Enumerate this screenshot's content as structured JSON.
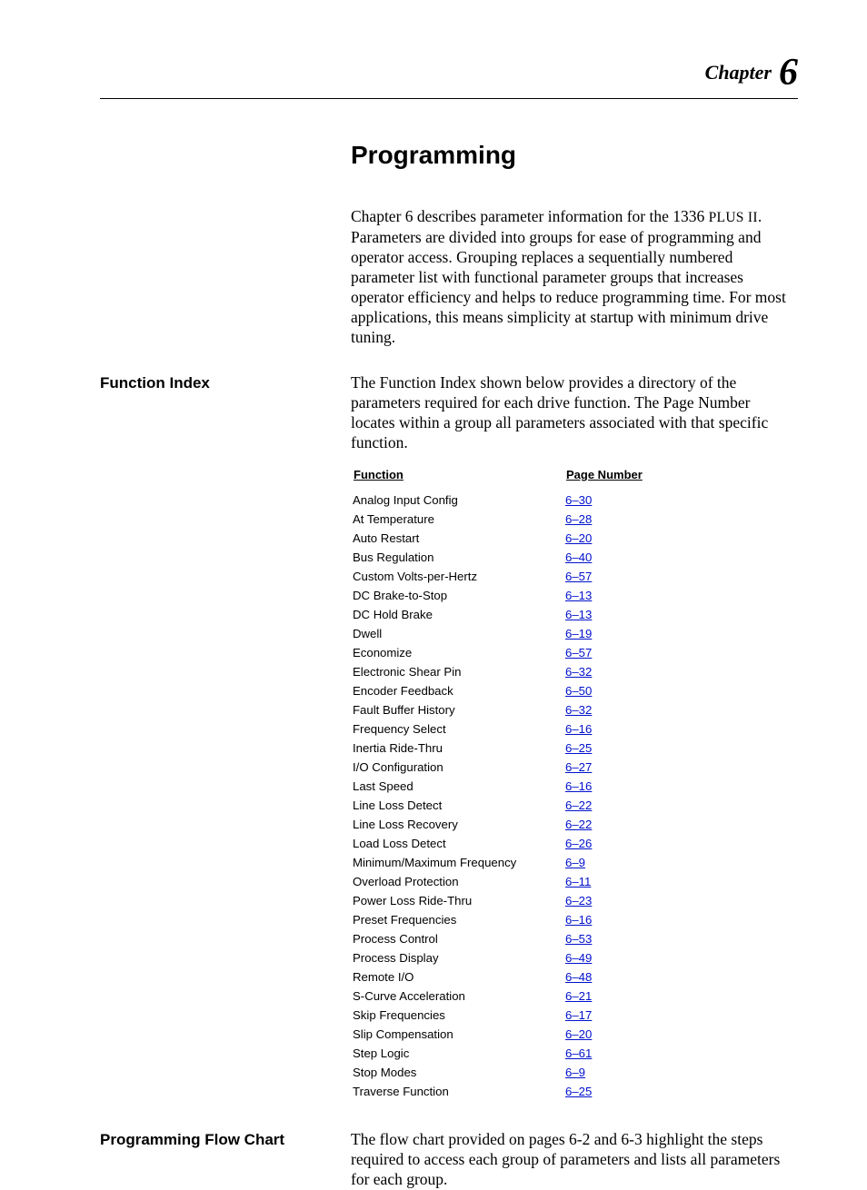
{
  "header": {
    "chapter_word": "Chapter",
    "chapter_number": "6"
  },
  "title": "Programming",
  "intro": "Chapter 6 describes parameter information for the 1336 PLUS II. Parameters are divided into groups for ease of programming and operator access. Grouping replaces a sequentially numbered parameter list with functional parameter groups that increases operator efficiency and helps to reduce programming time. For most applications, this means simplicity at startup with minimum drive tuning.",
  "function_index": {
    "heading": "Function Index",
    "body": "The Function Index shown below provides a directory of the parameters required for each drive function. The Page Number locates within a group all parameters associated with that specific function.",
    "table": {
      "col1": "Function",
      "col2": "Page Number",
      "rows": [
        {
          "f": "Analog Input Config",
          "p": "6–30"
        },
        {
          "f": "At Temperature",
          "p": "6–28"
        },
        {
          "f": "Auto Restart",
          "p": "6–20"
        },
        {
          "f": "Bus Regulation",
          "p": "6–40"
        },
        {
          "f": "Custom Volts-per-Hertz",
          "p": "6–57"
        },
        {
          "f": "DC Brake-to-Stop",
          "p": "6–13"
        },
        {
          "f": "DC Hold Brake",
          "p": "6–13"
        },
        {
          "f": "Dwell",
          "p": "6–19"
        },
        {
          "f": "Economize",
          "p": "6–57"
        },
        {
          "f": "Electronic Shear Pin",
          "p": "6–32"
        },
        {
          "f": "Encoder Feedback",
          "p": "6–50"
        },
        {
          "f": "Fault Buffer History",
          "p": "6–32"
        },
        {
          "f": "Frequency Select",
          "p": "6–16"
        },
        {
          "f": "Inertia Ride-Thru",
          "p": "6–25"
        },
        {
          "f": "I/O Configuration",
          "p": "6–27"
        },
        {
          "f": "Last Speed",
          "p": "6–16"
        },
        {
          "f": "Line Loss Detect",
          "p": "6–22"
        },
        {
          "f": "Line Loss Recovery",
          "p": "6–22"
        },
        {
          "f": "Load Loss Detect",
          "p": "6–26"
        },
        {
          "f": "Minimum/Maximum Frequency",
          "p": "6–9"
        },
        {
          "f": "Overload Protection",
          "p": "6–11"
        },
        {
          "f": "Power Loss Ride-Thru",
          "p": "6–23"
        },
        {
          "f": "Preset Frequencies",
          "p": "6–16"
        },
        {
          "f": "Process Control",
          "p": "6–53"
        },
        {
          "f": "Process Display",
          "p": "6–49"
        },
        {
          "f": "Remote I/O",
          "p": "6–48"
        },
        {
          "f": "S-Curve Acceleration",
          "p": "6–21"
        },
        {
          "f": "Skip Frequencies",
          "p": "6–17"
        },
        {
          "f": "Slip Compensation",
          "p": "6–20"
        },
        {
          "f": "Step Logic",
          "p": "6–61"
        },
        {
          "f": "Stop Modes",
          "p": "6–9"
        },
        {
          "f": "Traverse Function",
          "p": "6–25"
        }
      ]
    }
  },
  "flow_chart": {
    "heading": "Programming Flow Chart",
    "body": "The flow chart provided on pages 6-2 and 6-3 highlight the steps required to access each group of parameters and lists all parameters for each group."
  }
}
